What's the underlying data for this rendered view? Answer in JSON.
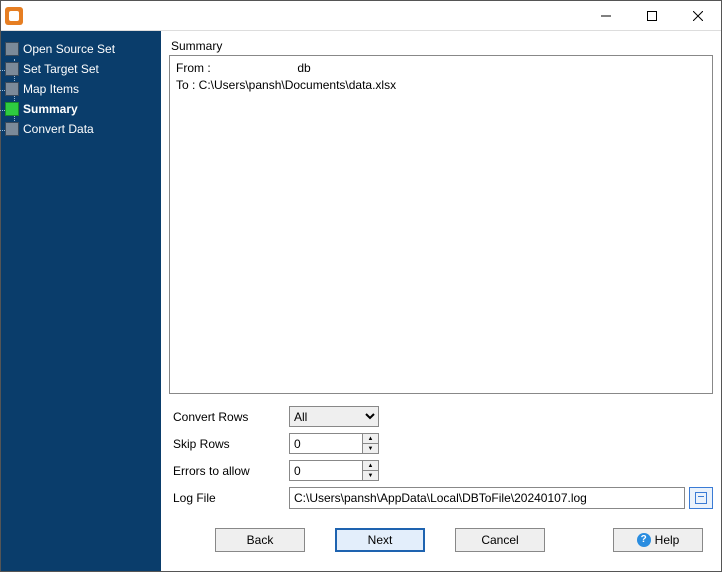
{
  "sidebar": {
    "root_label": "Open Source Set",
    "items": [
      {
        "label": "Set Target Set",
        "active": false
      },
      {
        "label": "Map Items",
        "active": false
      },
      {
        "label": "Summary",
        "active": true
      },
      {
        "label": "Convert Data",
        "active": false
      }
    ]
  },
  "main": {
    "summary_heading": "Summary",
    "summary_from_label": "From :",
    "summary_from_value": "db",
    "summary_to": "To : C:\\Users\\pansh\\Documents\\data.xlsx",
    "form": {
      "convert_rows": {
        "label": "Convert Rows",
        "value": "All"
      },
      "skip_rows": {
        "label": "Skip Rows",
        "value": "0"
      },
      "errors_allow": {
        "label": "Errors to allow",
        "value": "0"
      },
      "log_file": {
        "label": "Log File",
        "value": "C:\\Users\\pansh\\AppData\\Local\\DBToFile\\20240107.log"
      }
    }
  },
  "buttons": {
    "back": "Back",
    "next": "Next",
    "cancel": "Cancel",
    "help": "Help"
  }
}
